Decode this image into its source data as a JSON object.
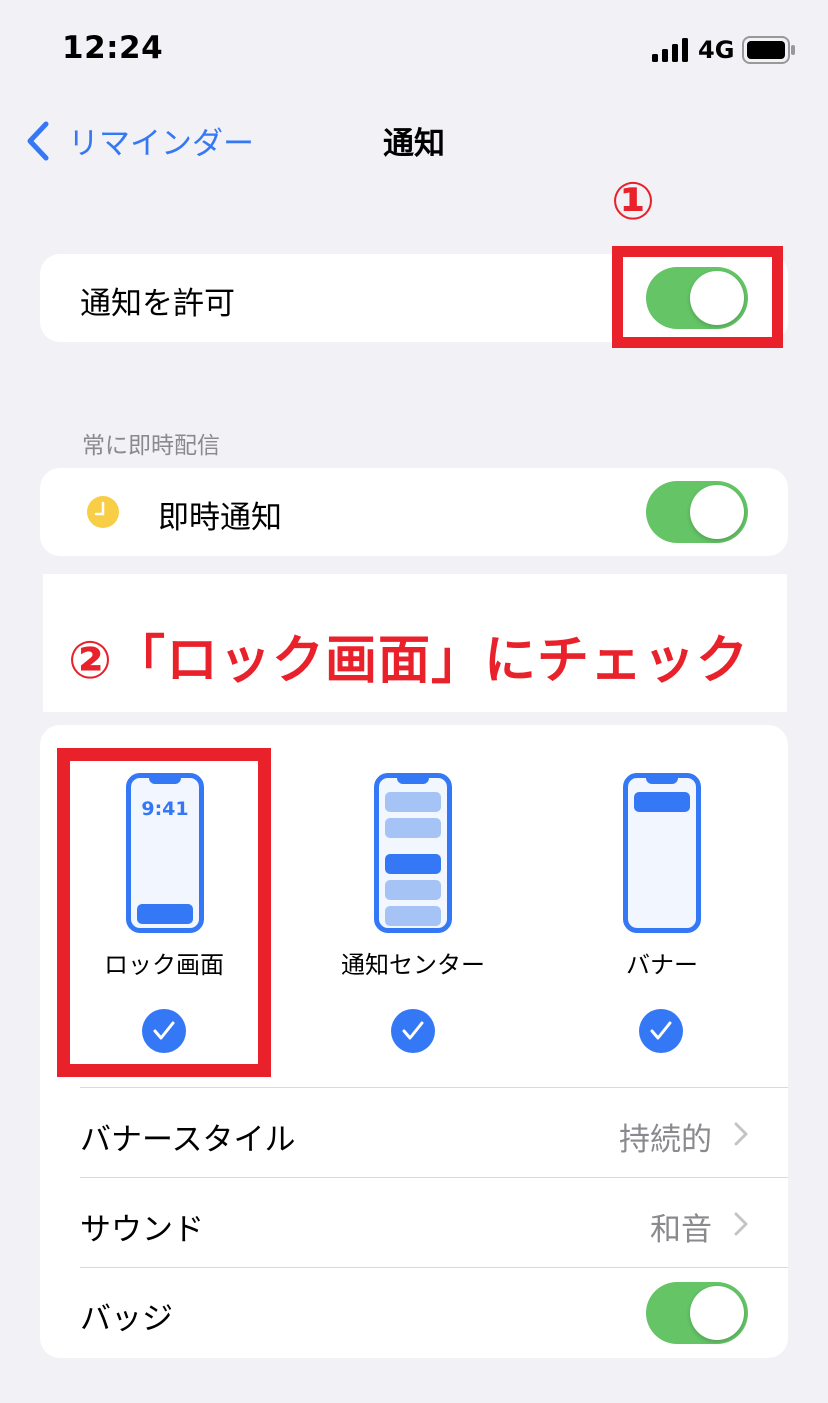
{
  "status_bar": {
    "time": "12:24",
    "network": "4G"
  },
  "nav": {
    "back_label": "リマインダー",
    "title": "通知"
  },
  "allow_notifications": {
    "label": "通知を許可",
    "enabled": true
  },
  "annotations": {
    "step1": "①",
    "step2": "②「ロック画面」にチェック",
    "highlight_color": "#e8212b"
  },
  "section": {
    "header": "常に即時配信"
  },
  "time_sensitive": {
    "label": "即時通知",
    "enabled": true,
    "icon": "clock-icon",
    "icon_color": "#f7ce46"
  },
  "alert_styles": [
    {
      "label": "ロック画面",
      "checked": true,
      "preview_time": "9:41"
    },
    {
      "label": "通知センター",
      "checked": true
    },
    {
      "label": "バナー",
      "checked": true
    }
  ],
  "rows": {
    "banner_style": {
      "label": "バナースタイル",
      "value": "持続的"
    },
    "sound": {
      "label": "サウンド",
      "value": "和音"
    },
    "badges": {
      "label": "バッジ",
      "enabled": true
    }
  },
  "colors": {
    "accent": "#3478f6",
    "toggle_on": "#64c466",
    "background": "#f1f1f6"
  }
}
